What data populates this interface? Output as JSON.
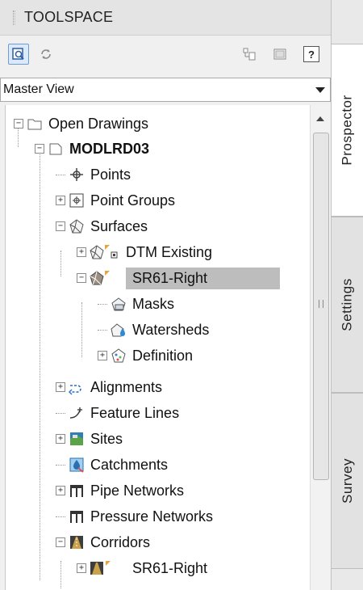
{
  "panel": {
    "title": "TOOLSPACE"
  },
  "toolbar": {
    "buttons": [
      {
        "icon": "item-view-icon"
      },
      {
        "icon": "refresh-icon"
      },
      {
        "icon": "structure-icon"
      },
      {
        "icon": "panel-icon"
      },
      {
        "icon": "help-icon",
        "label": "?"
      }
    ]
  },
  "view_selector": {
    "value": "Master View"
  },
  "tree": {
    "items": [
      {
        "label": "Open Drawings",
        "icon": "drawings-icon",
        "expander": "−"
      },
      {
        "label": "MODLRD03",
        "icon": "drawing-icon",
        "expander": "−"
      },
      {
        "label": "Points",
        "icon": "points-icon",
        "expander": ""
      },
      {
        "label": "Point Groups",
        "icon": "point-groups-icon",
        "expander": "+"
      },
      {
        "label": "Surfaces",
        "icon": "surfaces-icon",
        "expander": "−"
      },
      {
        "label": "DTM Existing",
        "icon": "surface-icon",
        "expander": "+"
      },
      {
        "label": "SR61-Right",
        "icon": "surface-icon",
        "expander": "−"
      },
      {
        "label": "Masks",
        "icon": "masks-icon",
        "expander": ""
      },
      {
        "label": "Watersheds",
        "icon": "watersheds-icon",
        "expander": ""
      },
      {
        "label": "Definition",
        "icon": "definition-icon",
        "expander": "+"
      },
      {
        "label": "Alignments",
        "icon": "alignments-icon",
        "expander": "+"
      },
      {
        "label": "Feature Lines",
        "icon": "feature-lines-icon",
        "expander": ""
      },
      {
        "label": "Sites",
        "icon": "sites-icon",
        "expander": "+"
      },
      {
        "label": "Catchments",
        "icon": "catchments-icon",
        "expander": ""
      },
      {
        "label": "Pipe Networks",
        "icon": "pipe-networks-icon",
        "expander": "+"
      },
      {
        "label": "Pressure Networks",
        "icon": "pressure-networks-icon",
        "expander": ""
      },
      {
        "label": "Corridors",
        "icon": "corridors-icon",
        "expander": "−"
      },
      {
        "label": "SR61-Right",
        "icon": "corridor-icon",
        "expander": "+"
      }
    ]
  },
  "side_tabs": [
    {
      "label": "Prospector",
      "active": true
    },
    {
      "label": "Settings",
      "active": false
    },
    {
      "label": "Survey",
      "active": false
    }
  ],
  "colors": {
    "selection": "#bdbdbd",
    "accent": "#2b5ea8",
    "flag": "#e8a33d"
  }
}
